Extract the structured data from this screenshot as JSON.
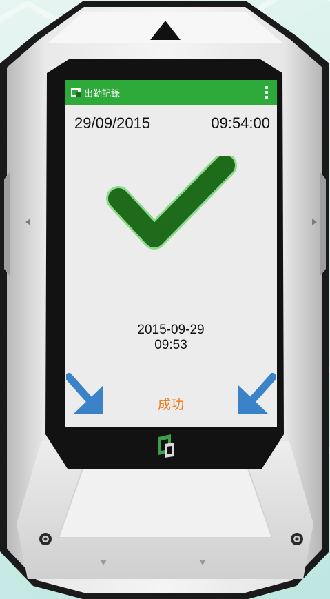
{
  "app": {
    "title": "出勤記錄",
    "date": "29/09/2015",
    "time": "09:54:00",
    "record_date": "2015-09-29",
    "record_time": "09:53",
    "status": "成功"
  },
  "icons": {
    "app_logo": "app-logo-icon",
    "menu": "overflow-menu-icon",
    "check": "checkmark-icon",
    "arrow_left": "arrow-down-right-icon",
    "arrow_right": "arrow-down-left-icon",
    "home": "home-logo-icon"
  },
  "colors": {
    "appbar": "#2eaa3a",
    "check": "#1f6b1c",
    "status": "#f07a1a",
    "arrows": "#3b83c9"
  }
}
